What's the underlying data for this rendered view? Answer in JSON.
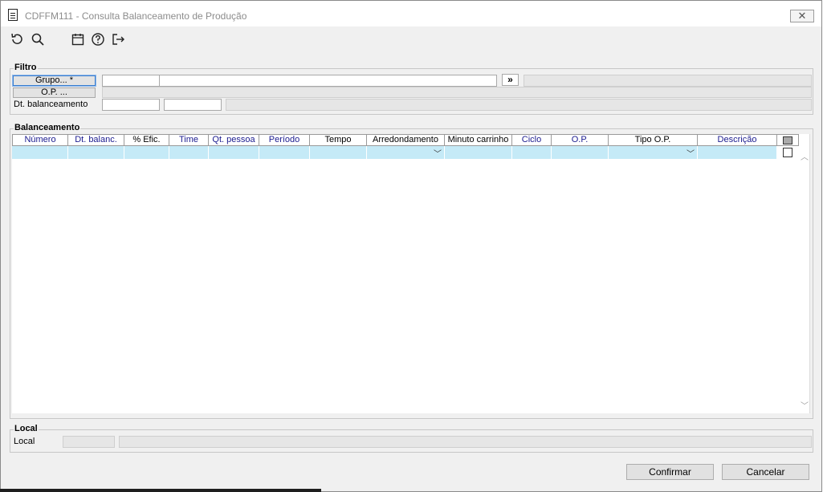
{
  "window": {
    "title": "CDFFM111 - Consulta Balanceamento de Produção",
    "close_label": "✕"
  },
  "toolbar": {
    "icons": [
      "refresh-icon",
      "search-icon",
      "calendar-icon",
      "help-icon",
      "exit-icon"
    ]
  },
  "filtro": {
    "label": "Filtro",
    "grupo_button": "Grupo... *",
    "op_button": "O.P. ...",
    "dt_label": "Dt. balanceamento",
    "more_button": "»"
  },
  "balanceamento": {
    "label": "Balanceamento",
    "columns": [
      "Número",
      "Dt. balanc.",
      "% Efic.",
      "Time",
      "Qt. pessoa",
      "Período",
      "Tempo",
      "Arredondamento",
      "Minuto carrinho",
      "Ciclo",
      "O.P.",
      "Tipo O.P.",
      "Descrição"
    ]
  },
  "local": {
    "group_label": "Local",
    "field_label": "Local"
  },
  "footer": {
    "confirm": "Confirmar",
    "cancel": "Cancelar"
  },
  "colors": {
    "row_highlight": "#c5eaf7",
    "header_blue": "#1b1b8f",
    "focus": "#3b7fd0"
  }
}
